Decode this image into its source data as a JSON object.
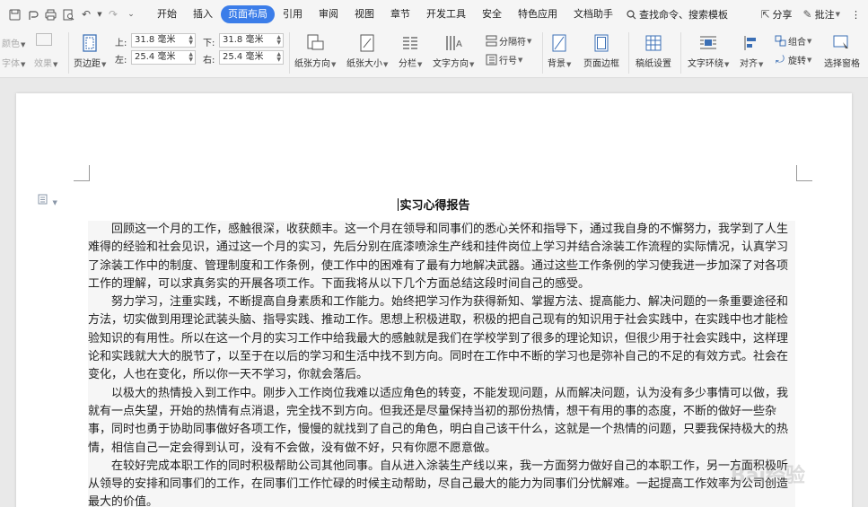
{
  "quick_access": [
    "save-icon",
    "undo-icon",
    "print-icon",
    "preview-icon",
    "redo-icon",
    "more-icon"
  ],
  "menu": {
    "items": [
      "开始",
      "插入",
      "页面布局",
      "引用",
      "审阅",
      "视图",
      "章节",
      "开发工具",
      "安全",
      "特色应用",
      "文档助手"
    ],
    "active": "页面布局",
    "search": "查找命令、搜索模板"
  },
  "top_right": {
    "share": "分享",
    "comment": "批注"
  },
  "ribbon": {
    "color": "颜色",
    "font": "字体",
    "effect": "效果",
    "margins": "页边距",
    "margin_top_label": "上:",
    "margin_top": "31.8 毫米",
    "margin_bottom_label": "下:",
    "margin_bottom": "31.8 毫米",
    "margin_left_label": "左:",
    "margin_left": "25.4 毫米",
    "margin_right_label": "右:",
    "margin_right": "25.4 毫米",
    "orientation": "纸张方向",
    "size": "纸张大小",
    "columns": "分栏",
    "text_direction": "文字方向",
    "breaks": "分隔符",
    "line_numbers": "行号",
    "background": "背景",
    "page_border": "页面边框",
    "grid_paper": "稿纸设置",
    "wrap_text": "文字环绕",
    "align": "对齐",
    "group": "组合",
    "rotate": "旋转",
    "selection_pane": "选择窗格"
  },
  "document": {
    "title": "实习心得报告",
    "paragraphs": [
      "回顾这一个月的工作，感触很深，收获颇丰。这一个月在领导和同事们的悉心关怀和指导下，通过我自身的不懈努力，我学到了人生难得的经验和社会见识，通过这一个月的实习，先后分别在底漆喷涂生产线和挂件岗位上学习并结合涂装工作流程的实际情况，认真学习了涂装工作中的制度、管理制度和工作条例，使工作中的困难有了最有力地解决武器。通过这些工作条例的学习使我进一步加深了对各项工作的理解，可以求真务实的开展各项工作。下面我将从以下几个方面总结这段时间自己的感受。",
      "努力学习，注重实践，不断提高自身素质和工作能力。始终把学习作为获得新知、掌握方法、提高能力、解决问题的一条重要途径和方法，切实做到用理论武装头脑、指导实践、推动工作。思想上积极进取，积极的把自己现有的知识用于社会实践中，在实践中也才能检验知识的有用性。所以在这一个月的实习工作中给我最大的感触就是我们在学校学到了很多的理论知识，但很少用于社会实践中，这样理论和实践就大大的脱节了，以至于在以后的学习和生活中找不到方向。同时在工作中不断的学习也是弥补自己的不足的有效方式。社会在变化，人也在变化，所以你一天不学习，你就会落后。",
      "以极大的热情投入到工作中。刚步入工作岗位我难以适应角色的转变，不能发现问题，从而解决问题，认为没有多少事情可以做，我就有一点失望，开始的热情有点消退，完全找不到方向。但我还是尽量保持当初的那份热情，想干有用的事的态度，不断的做好一些杂事，同时也勇于协助同事做好各项工作，慢慢的就找到了自己的角色，明白自己该干什么，这就是一个热情的问题，只要我保持极大的热情，相信自己一定会得到认可，没有不会做，没有做不好，只有你愿不愿意做。",
      "在较好完成本职工作的同时积极帮助公司其他同事。自从进入涂装生产线以来，我一方面努力做好自己的本职工作，另一方面积极听从领导的安排和同事们的工作，在同事们工作忙碌的时候主动帮助，尽自己最大的能力为同事们分忧解难。一起提高工作效率为公司创造最大的价值。"
    ]
  },
  "watermark": "Bai经验"
}
